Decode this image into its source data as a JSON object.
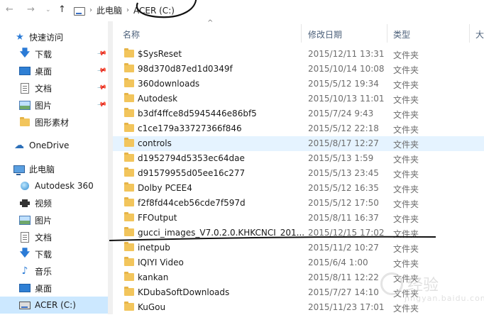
{
  "address": {
    "crumbs": [
      "此电脑",
      "ACER (C:)"
    ],
    "separator": "›"
  },
  "sidebar": {
    "items": [
      {
        "icon": "star-icon",
        "label": "快速访问",
        "pinned": false
      },
      {
        "icon": "download-icon",
        "label": "下载",
        "pinned": true
      },
      {
        "icon": "desktop-icon",
        "label": "桌面",
        "pinned": true
      },
      {
        "icon": "document-icon",
        "label": "文档",
        "pinned": true
      },
      {
        "icon": "picture-icon",
        "label": "图片",
        "pinned": true
      },
      {
        "icon": "folder-icon",
        "label": "图形素材",
        "pinned": false
      },
      {
        "icon": "onedrive-icon",
        "label": "OneDrive",
        "pinned": false
      },
      {
        "icon": "computer-icon",
        "label": "此电脑",
        "pinned": false
      },
      {
        "icon": "network-drive-icon",
        "label": "Autodesk 360",
        "pinned": false
      },
      {
        "icon": "video-icon",
        "label": "视频",
        "pinned": false
      },
      {
        "icon": "picture-icon",
        "label": "图片",
        "pinned": false
      },
      {
        "icon": "document-icon",
        "label": "文档",
        "pinned": false
      },
      {
        "icon": "download-icon",
        "label": "下载",
        "pinned": false
      },
      {
        "icon": "music-icon",
        "label": "音乐",
        "pinned": false
      },
      {
        "icon": "desktop-icon",
        "label": "桌面",
        "pinned": false
      },
      {
        "icon": "drive-icon",
        "label": "ACER (C:)",
        "pinned": false,
        "selected": true
      }
    ]
  },
  "columns": {
    "name": "名称",
    "date": "修改日期",
    "type": "类型",
    "size": "大"
  },
  "files": [
    {
      "name": "$SysReset",
      "date": "2015/12/11 13:31",
      "type": "文件夹"
    },
    {
      "name": "98d370d87ed1d0349f",
      "date": "2015/10/14 10:08",
      "type": "文件夹"
    },
    {
      "name": "360downloads",
      "date": "2015/5/12 19:34",
      "type": "文件夹"
    },
    {
      "name": "Autodesk",
      "date": "2015/10/13 11:01",
      "type": "文件夹"
    },
    {
      "name": "b3df4ffce8d5945446e86bf5",
      "date": "2015/7/24 9:43",
      "type": "文件夹"
    },
    {
      "name": "c1ce179a33727366f846",
      "date": "2015/5/12 22:18",
      "type": "文件夹"
    },
    {
      "name": "controls",
      "date": "2015/8/17 12:27",
      "type": "文件夹",
      "hover": true
    },
    {
      "name": "d1952794d5353ec64dae",
      "date": "2015/5/13 1:59",
      "type": "文件夹"
    },
    {
      "name": "d91579955d05ee16c277",
      "date": "2015/5/13 23:45",
      "type": "文件夹"
    },
    {
      "name": "Dolby PCEE4",
      "date": "2015/5/12 16:35",
      "type": "文件夹"
    },
    {
      "name": "f2f8fd44ceb56cde7f597d",
      "date": "2015/5/12 17:50",
      "type": "文件夹"
    },
    {
      "name": "FFOutput",
      "date": "2015/8/11 16:37",
      "type": "文件夹"
    },
    {
      "name": "gucci_images_V7.0.2.0.KHKCNCI_201...",
      "date": "2015/12/15 17:02",
      "type": "文件夹"
    },
    {
      "name": "inetpub",
      "date": "2015/11/2 10:27",
      "type": "文件夹"
    },
    {
      "name": "IQIYI Video",
      "date": "2015/6/4 1:00",
      "type": "文件夹"
    },
    {
      "name": "kankan",
      "date": "2015/8/11 12:22",
      "type": "文件夹"
    },
    {
      "name": "KDubaSoftDownloads",
      "date": "2015/7/27 14:10",
      "type": "文件夹"
    },
    {
      "name": "KuGou",
      "date": "2015/11/23 17:01",
      "type": "文件夹"
    }
  ],
  "colors": {
    "selected": "#cce8ff",
    "hover": "#e5f3ff",
    "folder": "#f2c55c",
    "accent": "#2b7bd6"
  }
}
